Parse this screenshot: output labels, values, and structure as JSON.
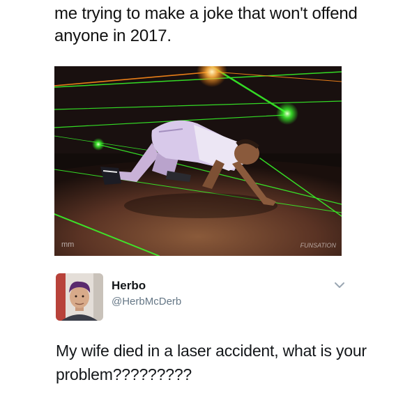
{
  "meme": {
    "caption": "me trying to make a joke that won't offend anyone in 2017.",
    "photo": {
      "watermark": "FUNSATION",
      "corner_mark": "mm",
      "laser_color": "#39ff2a"
    }
  },
  "tweet": {
    "display_name": "Herbo",
    "handle": "@HerbMcDerb",
    "text": "My wife died in a laser accident, what is your problem?????????",
    "avatar_icon": "profile-photo"
  },
  "icons": {
    "menu": "chevron-down-icon"
  }
}
